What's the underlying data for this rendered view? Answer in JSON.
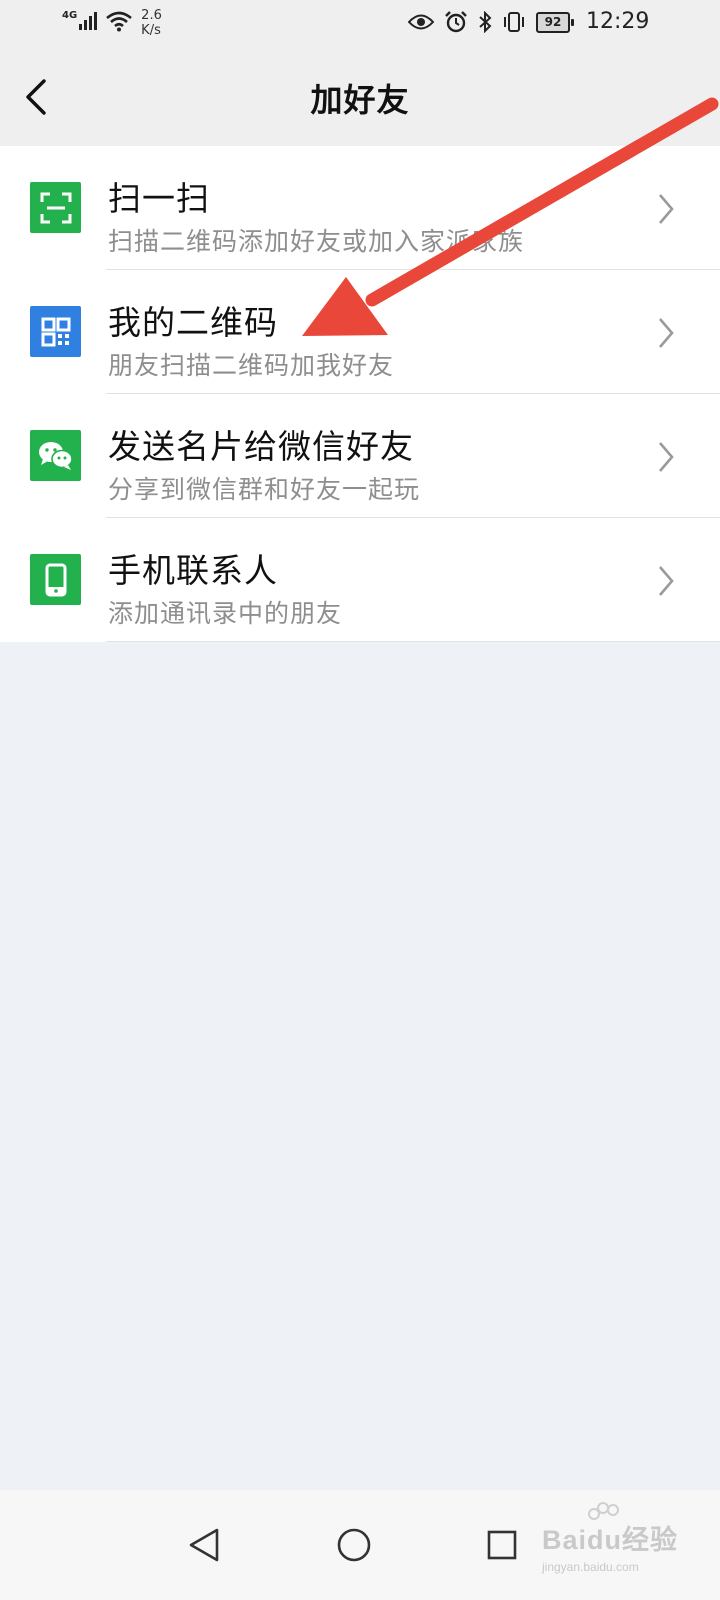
{
  "status_bar": {
    "network_type": "4G",
    "speed_value": "2.6",
    "speed_unit": "K/s",
    "battery": "92",
    "time": "12:29",
    "icons": [
      "signal-icon",
      "wifi-icon",
      "eye-icon",
      "alarm-icon",
      "bluetooth-icon",
      "vibrate-icon",
      "battery-icon"
    ]
  },
  "header": {
    "title": "加好友",
    "back_icon": "back-arrow-icon"
  },
  "menu": [
    {
      "title": "扫一扫",
      "subtitle": "扫描二维码添加好友或加入家派家族",
      "icon": "scan-icon",
      "icon_color": "#22b14c"
    },
    {
      "title": "我的二维码",
      "subtitle": "朋友扫描二维码加我好友",
      "icon": "qr-code-icon",
      "icon_color": "#2f80e0"
    },
    {
      "title": "发送名片给微信好友",
      "subtitle": "分享到微信群和好友一起玩",
      "icon": "wechat-icon",
      "icon_color": "#22b14c"
    },
    {
      "title": "手机联系人",
      "subtitle": "添加通讯录中的朋友",
      "icon": "phone-icon",
      "icon_color": "#22b14c"
    }
  ],
  "navigation": [
    "back-nav-icon",
    "home-nav-icon",
    "recents-nav-icon"
  ],
  "watermark": {
    "main": "Baidu经验",
    "sub": "jingyan.baidu.com"
  },
  "colors": {
    "accent_green": "#22b14c",
    "accent_blue": "#2f80e0",
    "annotation_arrow": "#e8473a",
    "background": "#eef1f6",
    "header_bg": "#efefef"
  }
}
